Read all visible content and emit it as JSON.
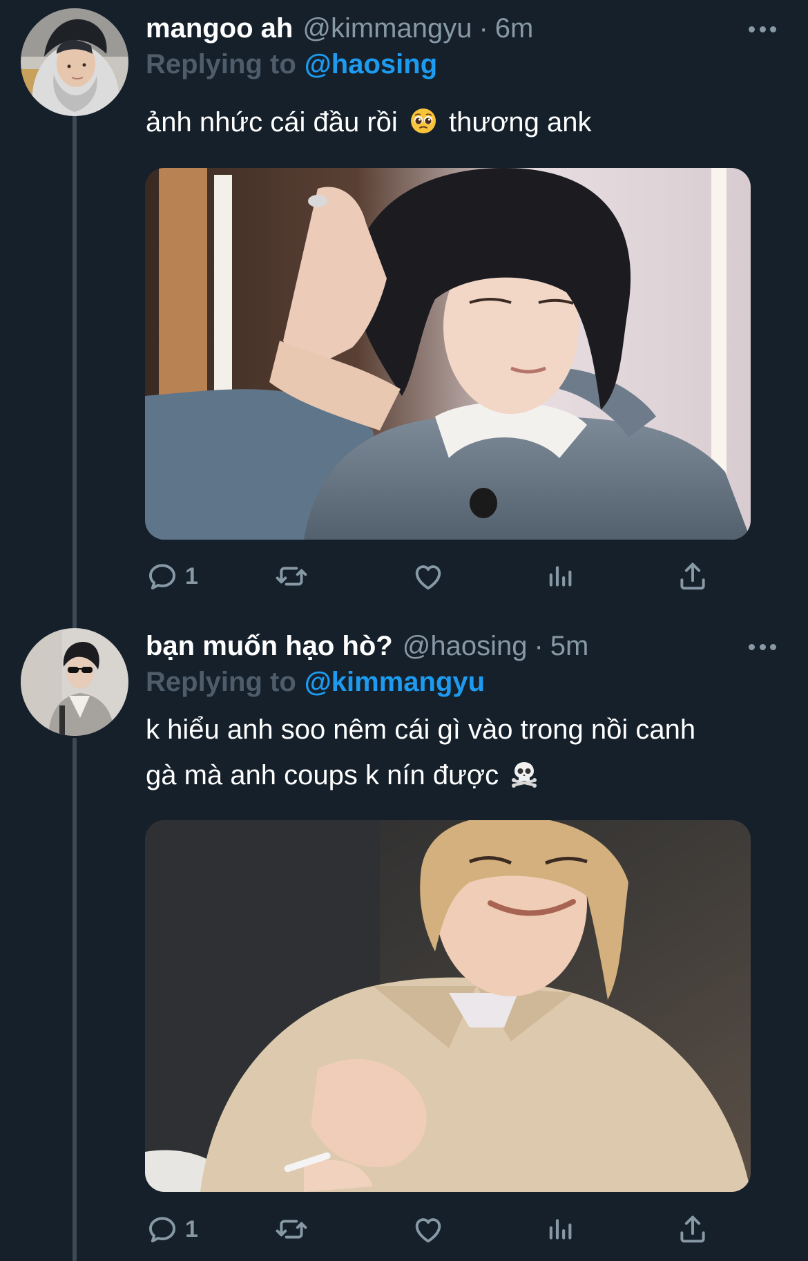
{
  "colors": {
    "background": "#15202b",
    "text_primary": "#ffffff",
    "text_secondary": "#8899a6",
    "link": "#1d9bf0",
    "thread_line": "#3d4a56"
  },
  "tweets": [
    {
      "display_name": "mangoo ah",
      "handle": "@kimmangyu",
      "separator": "·",
      "time": "6m",
      "reply_prefix": "Replying to",
      "reply_to": "@haosing",
      "text_before_emoji": "ảnh nhức cái đầu rồi",
      "emoji": "pleading-face-emoji",
      "text_after_emoji": "thương ank",
      "media": "photo",
      "actions": {
        "reply_icon": "reply-icon",
        "reply_count": "1",
        "retweet_icon": "retweet-icon",
        "like_icon": "heart-icon",
        "analytics_icon": "analytics-icon",
        "share_icon": "share-icon"
      }
    },
    {
      "display_name": "bạn muốn hạo hò?",
      "handle": "@haosing",
      "separator": "·",
      "time": "5m",
      "reply_prefix": "Replying to",
      "reply_to": "@kimmangyu",
      "text_line1": "k hiểu anh soo nêm cái gì vào trong nồi canh",
      "text_line2": "gà mà anh coups k nín được",
      "emoji": "skull-crossbones-emoji",
      "media": "photo",
      "actions": {
        "reply_icon": "reply-icon",
        "reply_count": "1",
        "retweet_icon": "retweet-icon",
        "like_icon": "heart-icon",
        "analytics_icon": "analytics-icon",
        "share_icon": "share-icon"
      }
    }
  ]
}
